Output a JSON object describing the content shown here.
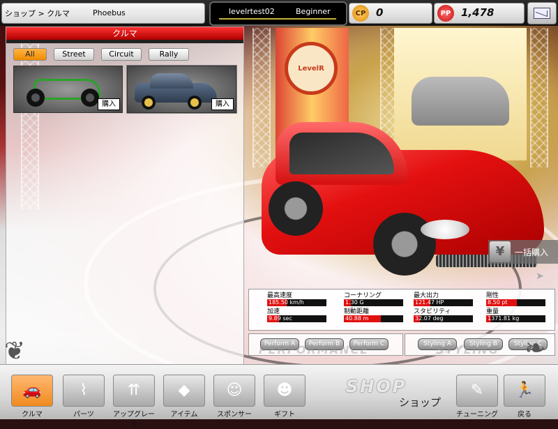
{
  "header": {
    "breadcrumb": "ショップ > クルマ",
    "car_name": "Phoebus",
    "user": {
      "name": "levelrtest02",
      "rank": "Beginner"
    },
    "cp": {
      "icon_label": "CP",
      "value": "0"
    },
    "pp": {
      "icon_label": "PP",
      "value": "1,478"
    },
    "mail_icon": "mail-icon"
  },
  "car_panel": {
    "title": "クルマ",
    "filters": [
      {
        "label": "All",
        "active": true
      },
      {
        "label": "Street",
        "active": false
      },
      {
        "label": "Circuit",
        "active": false
      },
      {
        "label": "Rally",
        "active": false
      }
    ],
    "cars": [
      {
        "buy_label": "購入",
        "color": "#29a329"
      },
      {
        "buy_label": "購入",
        "color": "#3b4a5e"
      }
    ]
  },
  "scene": {
    "sign_text": "LevelR"
  },
  "bulk_buy": {
    "label": "一括購入",
    "icon": "¥"
  },
  "stats": [
    {
      "label": "最高速度",
      "value": "185.50 km/h",
      "fill": 0.33
    },
    {
      "label": "コーナリング",
      "value": "1.30 G",
      "fill": 0.12
    },
    {
      "label": "最大出力",
      "value": "121.47 HP",
      "fill": 0.28
    },
    {
      "label": "剛性",
      "value": "8.50 pt",
      "fill": 0.52
    },
    {
      "label": "加速",
      "value": "9.89 sec",
      "fill": 0.2
    },
    {
      "label": "制動距離",
      "value": "40.88 m",
      "fill": 0.62
    },
    {
      "label": "スタビリティ",
      "value": "32.07 deg",
      "fill": 0.1
    },
    {
      "label": "重量",
      "value": "1371.81 kg",
      "fill": 0.08
    }
  ],
  "modes": {
    "performance": {
      "caption": "PERFORMANCE",
      "buttons": [
        "Perform A",
        "Perform B",
        "Perform C"
      ]
    },
    "styling": {
      "caption": "STYLING",
      "buttons": [
        "Styling A",
        "Styling B",
        "Styling C"
      ]
    }
  },
  "bottom_nav": {
    "items": [
      {
        "label": "クルマ",
        "icon": "car-icon",
        "active": true
      },
      {
        "label": "パーツ",
        "icon": "spring-icon",
        "active": false
      },
      {
        "label": "アップグレード",
        "icon": "upgrade-icon",
        "active": false
      },
      {
        "label": "アイテム",
        "icon": "item-icon",
        "active": false
      },
      {
        "label": "スポンサー",
        "icon": "sponsor-icon",
        "active": false
      },
      {
        "label": "ギフト",
        "icon": "gift-icon",
        "active": false
      }
    ],
    "shop_logo": "SHOP",
    "shop_label": "ショップ",
    "tuning": {
      "label": "チューニング",
      "icon": "wrench-icon"
    },
    "back": {
      "label": "戻る",
      "icon": "back-icon"
    }
  },
  "colors": {
    "accent": "#f08c00",
    "panel_header": "#c00000",
    "stat_fill": "#e01010"
  }
}
